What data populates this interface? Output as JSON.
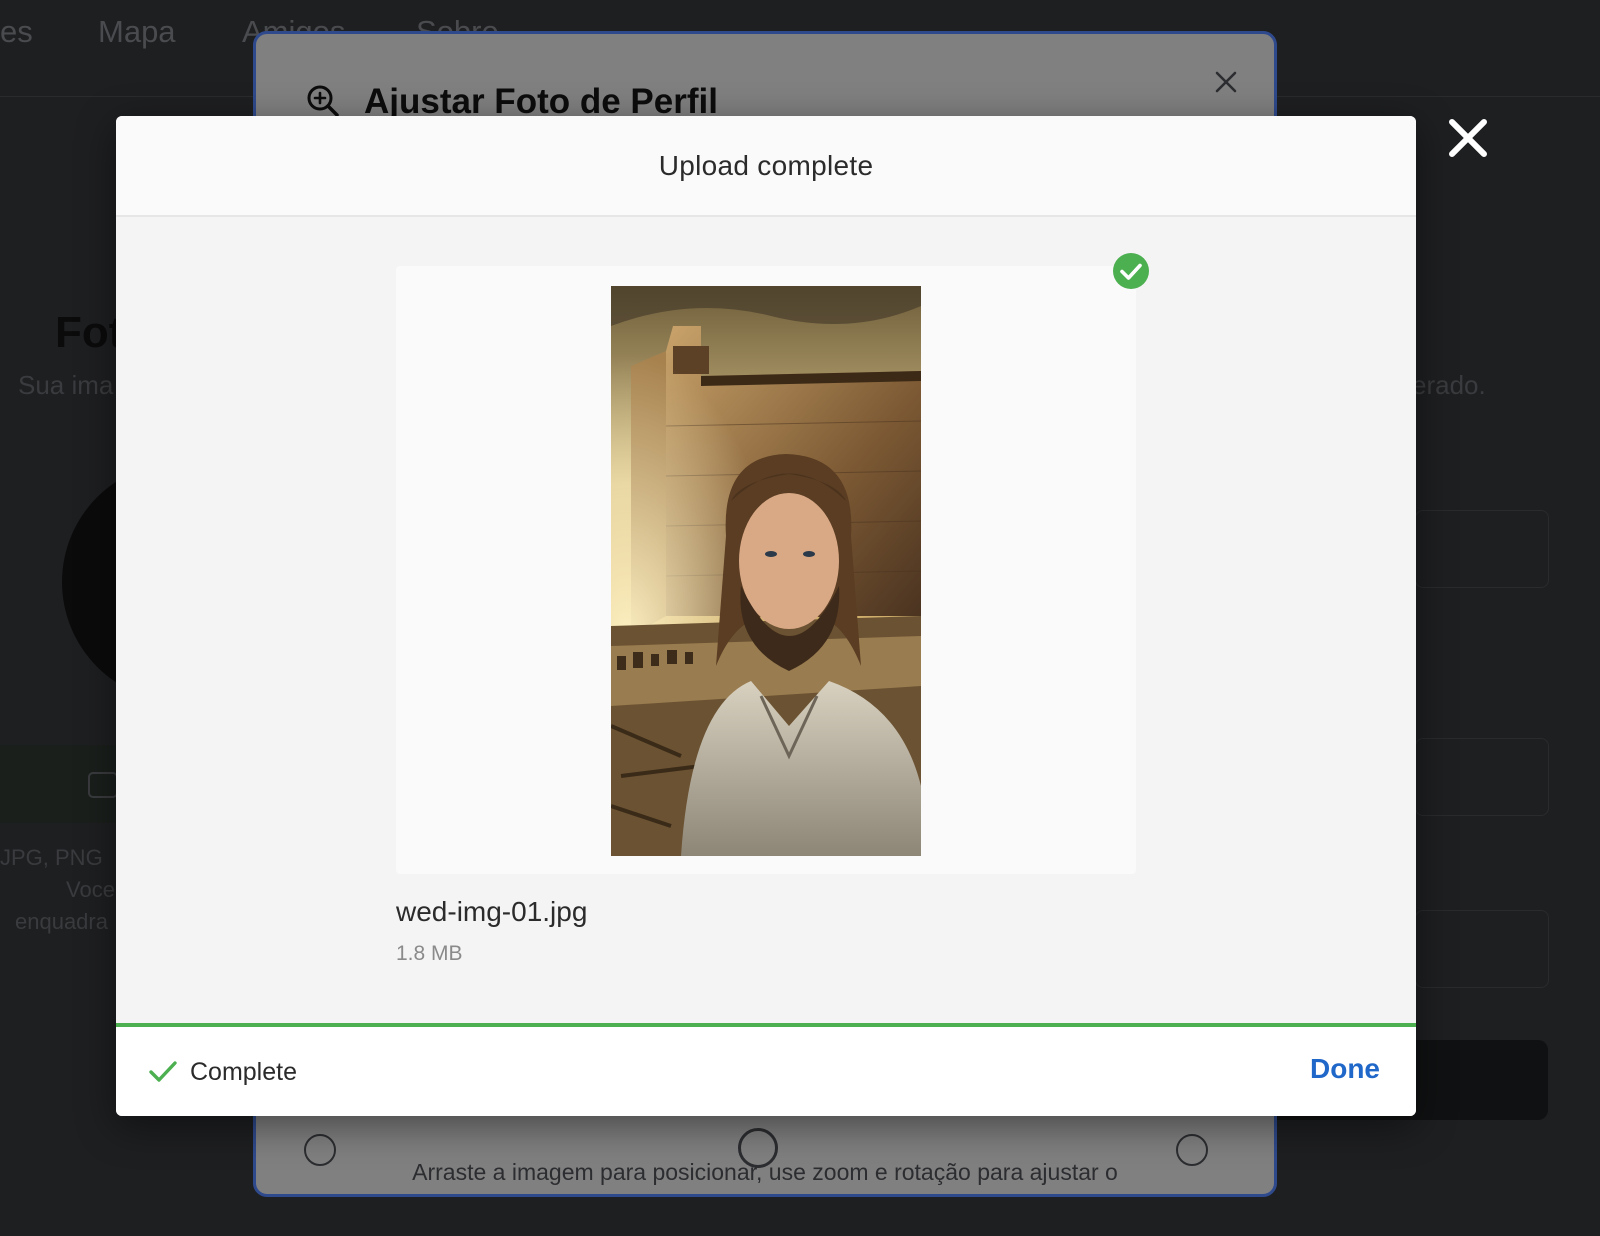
{
  "background": {
    "nav_items": [
      "es",
      "Mapa",
      "Amigos",
      "Sobre"
    ],
    "page_title": "Fot",
    "subtitle_left": "Sua ima",
    "subtitle_right": "erado.",
    "hint_lines": [
      "JPG, PNG",
      "Voce",
      "enquadra"
    ]
  },
  "adjust_modal": {
    "title": "Ajustar Foto de Perfil",
    "help_text": "Arraste a imagem para posicionar, use zoom e rotação para ajustar o"
  },
  "upload_modal": {
    "header_title": "Upload complete",
    "file_name": "wed-img-01.jpg",
    "file_size": "1.8 MB",
    "status_text": "Complete",
    "done_label": "Done",
    "progress": 1.0
  },
  "icons": {
    "overlay_close": "close-icon",
    "file_status": "check-circle-icon",
    "footer_status": "checkmark-icon",
    "adjust_title": "zoom-in-icon",
    "adjust_close": "close-icon"
  },
  "colors": {
    "success": "#4caf50",
    "link": "#1f67c9",
    "adjust_border": "#2f4a8c"
  }
}
